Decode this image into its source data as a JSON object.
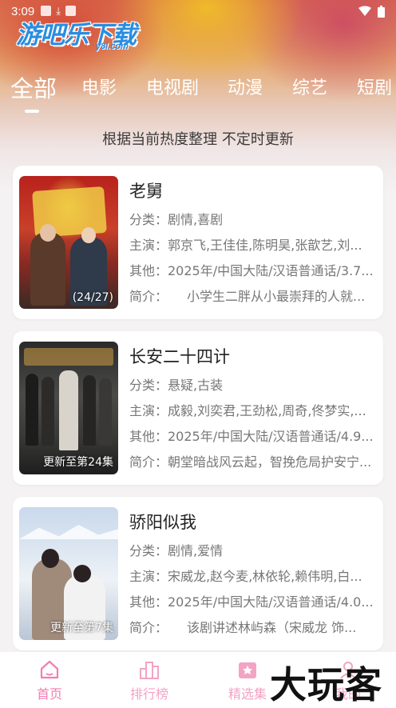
{
  "status_bar": {
    "time": "3:09"
  },
  "logo": {
    "text": "游吧乐下载",
    "sub": "y8l.com"
  },
  "tabs": [
    {
      "label": "全部",
      "active": true
    },
    {
      "label": "电影"
    },
    {
      "label": "电视剧"
    },
    {
      "label": "动漫"
    },
    {
      "label": "综艺"
    },
    {
      "label": "短剧"
    }
  ],
  "subtitle": "根据当前热度整理 不定时更新",
  "items": [
    {
      "title": "老舅",
      "badge": "(24/27)",
      "category": "分类：剧情,喜剧",
      "cast": "主演：郭京飞,王佳佳,陈明昊,张歆艺,刘...",
      "other": "其他：2025年/中国大陆/汉语普通话/3.7...",
      "intro": "简介：　　小学生二胖从小最崇拜的人就..."
    },
    {
      "title": "长安二十四计",
      "badge": "更新至第24集",
      "category": "分类：悬疑,古装",
      "cast": "主演：成毅,刘奕君,王劲松,周奇,佟梦实,...",
      "other": "其他：2025年/中国大陆/汉语普通话/4.9...",
      "intro": "简介：朝堂暗战风云起，智挽危局护安宁..."
    },
    {
      "title": "骄阳似我",
      "badge": "更新至第7集",
      "category": "分类：剧情,爱情",
      "cast": "主演：宋威龙,赵今麦,林依轮,赖伟明,白...",
      "other": "其他：2025年/中国大陆/汉语普通话/4.0...",
      "intro": "简介：　　该剧讲述林屿森（宋威龙 饰..."
    }
  ],
  "bottom_nav": [
    {
      "label": "首页",
      "icon": "home-icon",
      "active": true
    },
    {
      "label": "排行榜",
      "icon": "ranking-icon"
    },
    {
      "label": "精选集",
      "icon": "collection-icon"
    },
    {
      "label": "我的",
      "icon": "profile-icon"
    }
  ],
  "watermark": "大玩客",
  "colors": {
    "accent": "#f07fb0",
    "nav_inactive": "#f3a3c4",
    "logo_blue": "#2a8de0"
  }
}
